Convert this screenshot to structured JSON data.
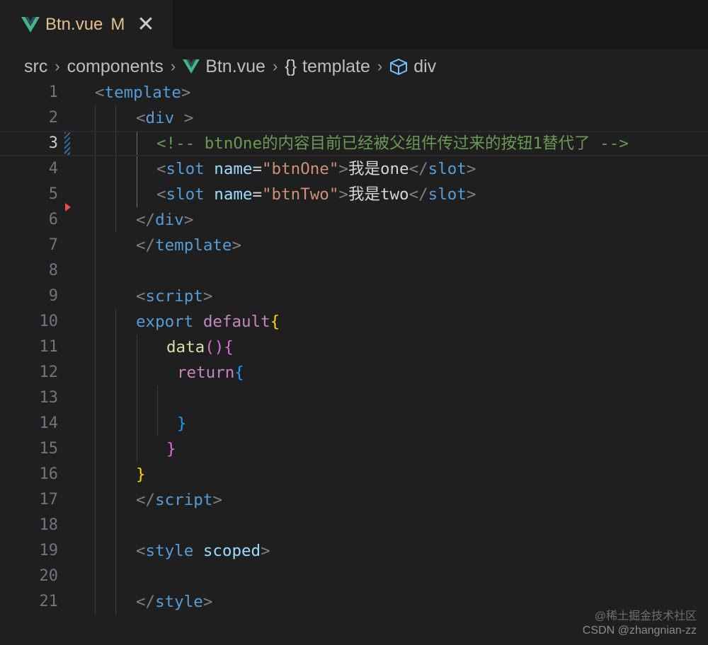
{
  "tab": {
    "title": "Btn.vue",
    "modified_badge": "M",
    "close_glyph": "✕",
    "icon": "vue-icon",
    "title_color": "#e2c08d"
  },
  "breadcrumb": {
    "items": [
      "src",
      "components",
      "Btn.vue",
      "template",
      "div"
    ],
    "separator": "›",
    "braces_glyph": "{}"
  },
  "editor": {
    "active_line": 3,
    "line_numbers": [
      "1",
      "2",
      "3",
      "4",
      "5",
      "6",
      "7",
      "8",
      "9",
      "10",
      "11",
      "12",
      "13",
      "14",
      "15",
      "16",
      "17",
      "18",
      "19",
      "20",
      "21"
    ],
    "code": {
      "l1": {
        "o": "<",
        "tag": "template",
        "c": ">"
      },
      "l2": {
        "o": "<",
        "tag": "div",
        "c": " >"
      },
      "l3": {
        "comment": "<!-- btnOne的内容目前已经被父组件传过来的按钮1替代了 -->"
      },
      "l4": {
        "o": "<",
        "tag": "slot",
        "sp": " ",
        "attr": "name",
        "eq": "=",
        "val": "\"btnOne\"",
        "c": ">",
        "text": "我是one",
        "o2": "</",
        "tag2": "slot",
        "c2": ">"
      },
      "l5": {
        "o": "<",
        "tag": "slot",
        "sp": " ",
        "attr": "name",
        "eq": "=",
        "val": "\"btnTwo\"",
        "c": ">",
        "text": "我是two",
        "o2": "</",
        "tag2": "slot",
        "c2": ">"
      },
      "l6": {
        "o": "</",
        "tag": "div",
        "c": ">"
      },
      "l7": {
        "o": "</",
        "tag": "template",
        "c": ">"
      },
      "l9": {
        "o": "<",
        "tag": "script",
        "c": ">"
      },
      "l10": {
        "kw1": "export",
        "sp": " ",
        "kw2": "default",
        "brace": "{"
      },
      "l11": {
        "fn": "data",
        "paren": "()",
        "brace": "{"
      },
      "l12": {
        "kw": "return",
        "brace": "{"
      },
      "l14": {
        "brace": "}"
      },
      "l15": {
        "brace": "}"
      },
      "l16": {
        "brace": "}"
      },
      "l17": {
        "o": "</",
        "tag": "script",
        "c": ">"
      },
      "l19": {
        "o": "<",
        "tag": "style",
        "sp": " ",
        "attr": "scoped",
        "c": ">"
      },
      "l21": {
        "o": "</",
        "tag": "style",
        "c": ">"
      }
    }
  },
  "watermark": {
    "line1": "@稀土掘金技术社区",
    "line2": "CSDN @zhangnian-zz"
  },
  "colors": {
    "background": "#1f1f1f",
    "tabbar": "#181818",
    "tag": "#569cd6",
    "attr": "#9cdcfe",
    "string": "#ce9178",
    "comment": "#6a9955",
    "keyword": "#c586c0",
    "function": "#dcdcaa",
    "bracket_gold": "#ffd700",
    "bracket_orchid": "#da70d6",
    "bracket_blue": "#179fff",
    "modified_gutter": "#2f6fae",
    "deleted_gutter": "#f14c4c"
  }
}
